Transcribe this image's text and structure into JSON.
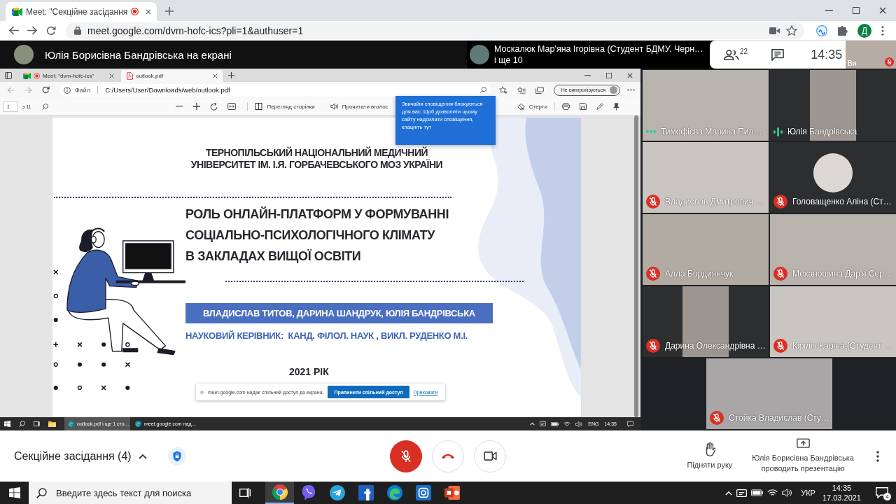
{
  "browser": {
    "tabs": [
      {
        "title": "Meet: \"Секційне засідання",
        "selected": true,
        "recording": true
      }
    ],
    "url": "meet.google.com/dvm-hofc-ics?pli=1&authuser=1",
    "profile_initial": "Д"
  },
  "meet_header": {
    "presenter_banner": "Юлія Борисівна Бандрівська на екрані",
    "pinned_name": "Москалюк Мар'яна Ігорівна (Студент БДМУ. Черн…",
    "pinned_more": "і ще 10",
    "people_count": "22",
    "time": "14:35",
    "self_tile": {
      "label": "Ви",
      "muted": true
    }
  },
  "shared_screen": {
    "tabs": [
      {
        "kind": "meet",
        "title": "Meet: \"dvm-hofc-ics\"",
        "selected": false,
        "recording": true
      },
      {
        "kind": "pdf",
        "title": "outlook.pdf",
        "selected": true,
        "recording": false
      }
    ],
    "address": {
      "scheme_label": "Файл",
      "path": "C:/Users/User/Downloads/web/outlook.pdf",
      "sync_label": "Не синхронізується"
    },
    "pdf_toolbar": {
      "page": "1",
      "page_total": "з 11",
      "buttons": [
        {
          "kind": "page-view",
          "label": "Перегляд сторінки"
        },
        {
          "kind": "read-aloud",
          "label": "Прочитати вголос"
        },
        {
          "kind": "erase",
          "label": "Стерти"
        }
      ]
    },
    "notification_popup": "Звичайні сповіщення блокуються для вас. Щоб дозволити цьому сайту надсилати сповіщення, клацніть тут",
    "slide": {
      "institution_lines": [
        "ТЕРНОПІЛЬСЬКИЙ НАЦІОНАЛЬНИЙ МЕДИЧНИЙ",
        "УНІВЕРСИТЕТ ІМ. І.Я. ГОРБАЧЕВСЬКОГО МОЗ УКРАЇНИ"
      ],
      "title_lines": [
        "РОЛЬ ОНЛАЙН-ПЛАТФОРМ У ФОРМУВАННІ",
        "СОЦІАЛЬНО-ПСИХОЛОГІЧНОГО КЛІМАТУ",
        "В ЗАКЛАДАХ ВИЩОЇ ОСВІТИ"
      ],
      "authors": "ВЛАДИСЛАВ ТИТОВ, ДАРИНА ШАНДРУК, ЮЛІЯ БАНДРІВСЬКА",
      "supervisor": "НАУКОВИЙ КЕРІВНИК:  КАНД. ФІЛОЛ. НАУК , ВИКЛ. РУДЕНКО М.І.",
      "year": "2021 РІК"
    },
    "share_bar": {
      "message": "meet.google.com надає спільний доступ до екрана.",
      "stop_button": "Припинити спільний доступ",
      "hide_link": "Приховати"
    },
    "taskbar": {
      "items": [
        {
          "label": "outlook.pdf і ще 1 сто…",
          "selected": true
        },
        {
          "label": "meet.google.com над…",
          "selected": false
        }
      ],
      "language": "ENG",
      "time": "14:35"
    }
  },
  "participants": [
    {
      "name": "Тимофієва Марина Пил…",
      "kind": "video",
      "mic": {
        "kind": "idle"
      }
    },
    {
      "name": "Юлія Бандрівська",
      "kind": "portrait",
      "mic": {
        "kind": "speaking"
      }
    },
    {
      "name": "Владислав Дмитрович …",
      "kind": "video",
      "mic": {
        "kind": "muted"
      }
    },
    {
      "name": "Головащенко Аліна (Ст…",
      "kind": "avatar",
      "mic": {
        "kind": "muted"
      }
    },
    {
      "name": "Алла Бордиянчук",
      "kind": "video",
      "mic": {
        "kind": "muted"
      }
    },
    {
      "name": "Механошина Дар'я Сер…",
      "kind": "video",
      "mic": {
        "kind": "muted"
      }
    },
    {
      "name": "Дарина Олександрівна …",
      "kind": "portrait",
      "mic": {
        "kind": "muted"
      }
    },
    {
      "name": "Кіріліч Каріна (Студент …",
      "kind": "video",
      "mic": {
        "kind": "muted"
      }
    },
    {
      "name": "Стойка Владислав (Сту…",
      "kind": "video",
      "mic": {
        "kind": "muted"
      }
    }
  ],
  "call_controls": {
    "meeting_title": "Секційне засідання (4)",
    "mic_muted": true,
    "camera_on": true,
    "raise_hand": "Підняти руку",
    "presenting_lines": [
      "Юлія Борисівна Бандрівська",
      "проводить презентацію"
    ]
  },
  "taskbar": {
    "search_placeholder": "Введите здесь текст для поиска",
    "apps": [
      {
        "kind": "browser",
        "active": true
      },
      {
        "kind": "messenger",
        "active": false
      },
      {
        "kind": "plane",
        "active": false
      },
      {
        "kind": "tile",
        "active": false
      },
      {
        "kind": "swirl",
        "active": false
      },
      {
        "kind": "camera",
        "active": false
      },
      {
        "kind": "slides",
        "active": false
      }
    ],
    "language": "УКР",
    "time": "14:35",
    "date": "17.03.2021",
    "notifications": "4"
  }
}
